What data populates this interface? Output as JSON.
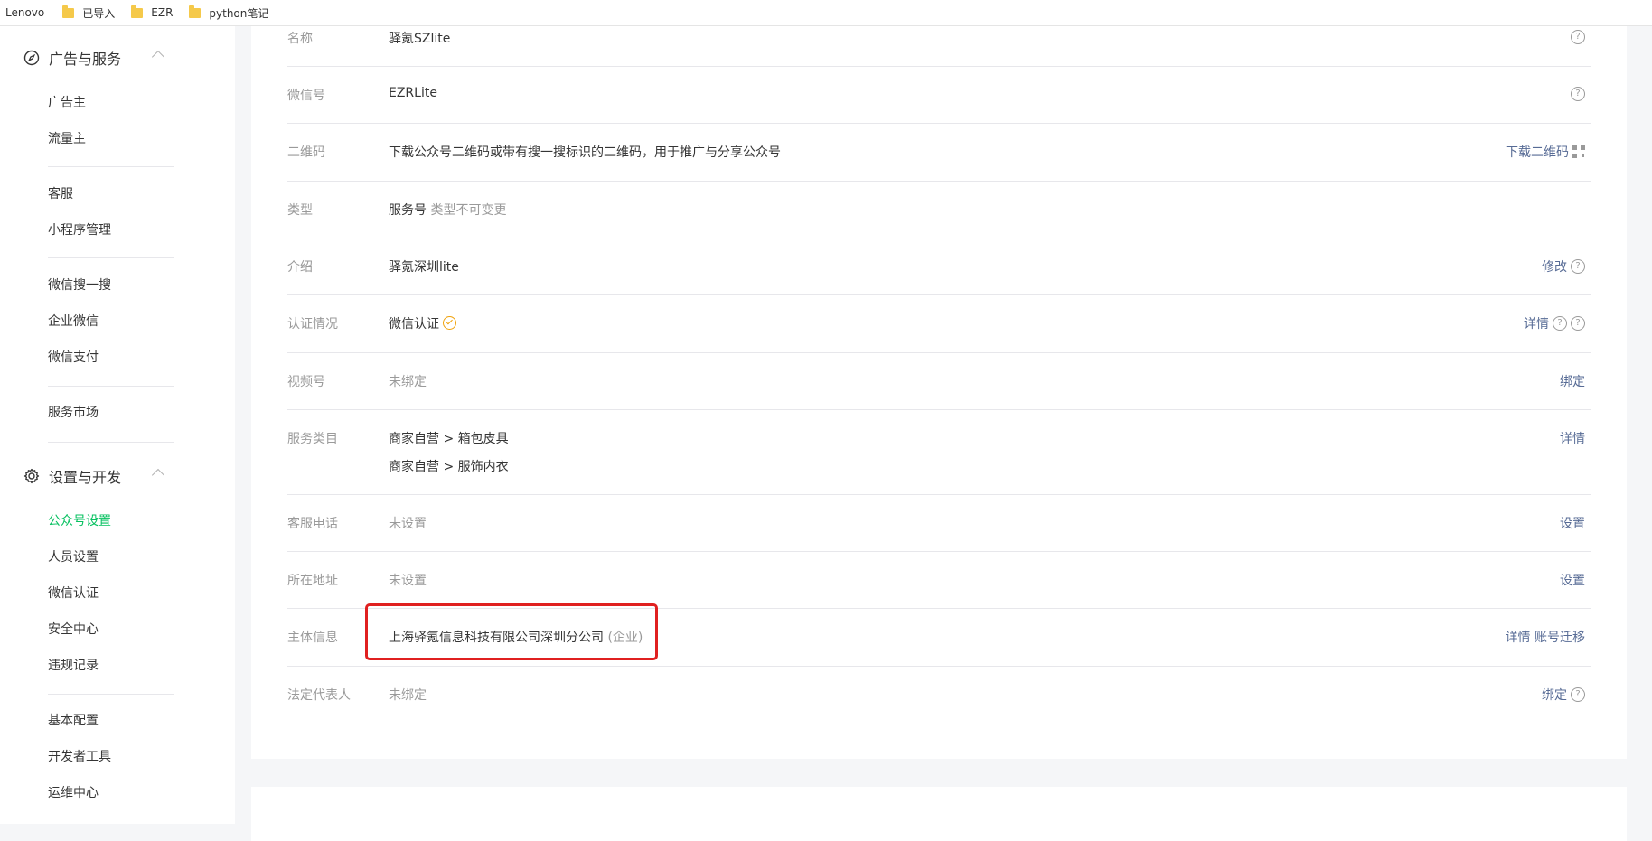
{
  "bookmarks": [
    {
      "label": "Lenovo",
      "folder": false
    },
    {
      "label": "已导入",
      "folder": true
    },
    {
      "label": "EZR",
      "folder": true
    },
    {
      "label": "python笔记",
      "folder": true
    }
  ],
  "sidebar": {
    "group1": {
      "title": "广告与服务",
      "icon": "compass-icon"
    },
    "group1_items": [
      "广告主",
      "流量主"
    ],
    "group1b_items": [
      "客服",
      "小程序管理"
    ],
    "group1c_items": [
      "微信搜一搜",
      "企业微信",
      "微信支付"
    ],
    "group1d_items": [
      "服务市场"
    ],
    "group2": {
      "title": "设置与开发",
      "icon": "gear-icon"
    },
    "group2_items": [
      "公众号设置",
      "人员设置",
      "微信认证",
      "安全中心",
      "违规记录"
    ],
    "group2b_items": [
      "基本配置",
      "开发者工具",
      "运维中心"
    ],
    "active_item": "公众号设置"
  },
  "settings": {
    "name": {
      "label": "名称",
      "value": "驿氪SZlite"
    },
    "wechat_id": {
      "label": "微信号",
      "value": "EZRLite"
    },
    "qrcode": {
      "label": "二维码",
      "value": "下载公众号二维码或带有搜一搜标识的二维码，用于推广与分享公众号",
      "action": "下载二维码"
    },
    "type": {
      "label": "类型",
      "value": "服务号",
      "note": "类型不可变更"
    },
    "intro": {
      "label": "介绍",
      "value": "驿氪深圳lite",
      "action": "修改"
    },
    "verify": {
      "label": "认证情况",
      "value": "微信认证",
      "action": "详情"
    },
    "video": {
      "label": "视频号",
      "value": "未绑定",
      "action": "绑定"
    },
    "category": {
      "label": "服务类目",
      "values": [
        "商家自营 > 箱包皮具",
        "商家自营 > 服饰内衣"
      ],
      "action": "详情"
    },
    "phone": {
      "label": "客服电话",
      "value": "未设置",
      "action": "设置"
    },
    "address": {
      "label": "所在地址",
      "value": "未设置",
      "action": "设置"
    },
    "entity": {
      "label": "主体信息",
      "value": "上海驿氪信息科技有限公司深圳分公司",
      "note": "(企业)",
      "action1": "详情",
      "action2": "账号迁移"
    },
    "legal": {
      "label": "法定代表人",
      "value": "未绑定",
      "action": "绑定"
    }
  },
  "colors": {
    "accent": "#07c160",
    "link": "#576b95",
    "highlight": "#e02020"
  }
}
